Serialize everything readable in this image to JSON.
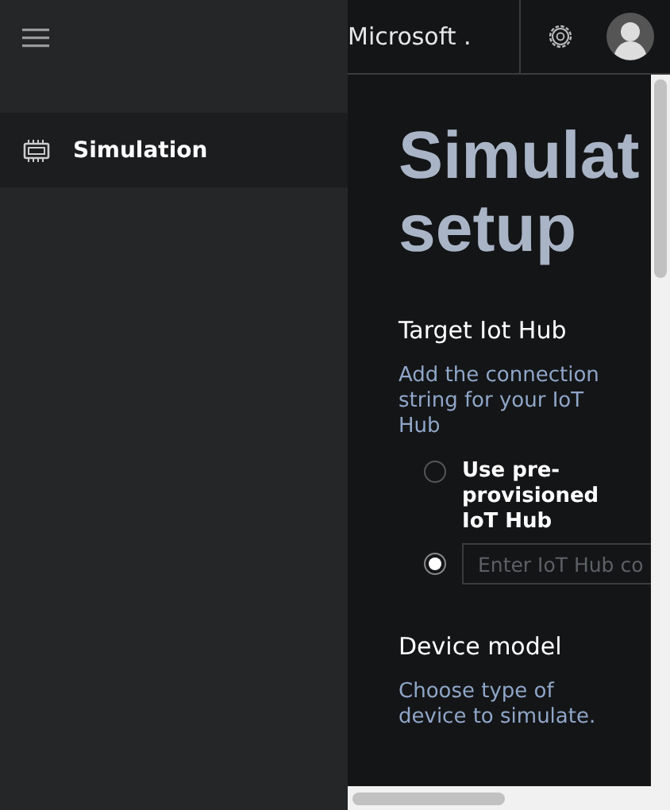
{
  "sidebar": {
    "items": [
      {
        "label": "Simulation",
        "selected": true
      }
    ]
  },
  "header": {
    "title": "Microsoft ."
  },
  "page": {
    "title_lines": [
      "Simulat",
      "setup"
    ],
    "sections": [
      {
        "heading": "Target Iot Hub",
        "description": "Add the connection string for your IoT Hub",
        "options": [
          {
            "kind": "label",
            "label": "Use pre-provisioned IoT Hub",
            "selected": false
          },
          {
            "kind": "field",
            "placeholder": "Enter IoT Hub co",
            "selected": true
          }
        ]
      },
      {
        "heading": "Device model",
        "description": "Choose type of device to simulate."
      }
    ]
  }
}
